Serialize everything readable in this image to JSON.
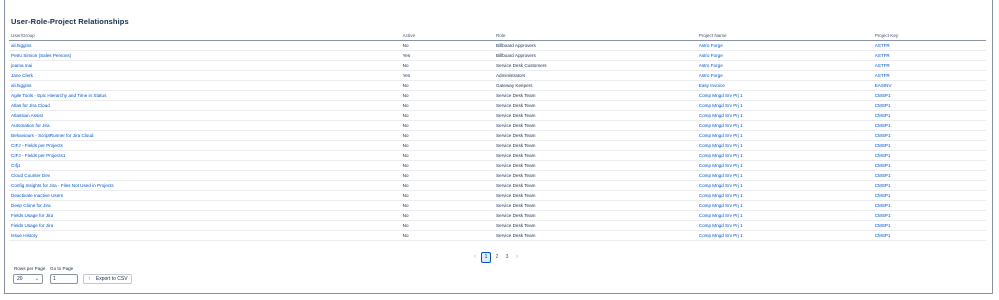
{
  "title": "User-Role-Project Relationships",
  "columns": {
    "user": "User/Group",
    "active": "Active",
    "role": "Role",
    "project_name": "Project Name",
    "project_key": "Project Key"
  },
  "rows": [
    {
      "user": "ali.higgins",
      "active": "No",
      "role": "Billboard Approvers",
      "project_name": "Astro Forge",
      "project_key": "ASTFR"
    },
    {
      "user": "Petru Simion (Sales Persons)",
      "active": "Yes",
      "role": "Billboard Approvers",
      "project_name": "Astro Forge",
      "project_key": "ASTFR"
    },
    {
      "user": "joama mai",
      "active": "No",
      "role": "Service Desk Customers",
      "project_name": "Astro Forge",
      "project_key": "ASTFR"
    },
    {
      "user": "Jane Clerk",
      "active": "Yes",
      "role": "Administrators",
      "project_name": "Astro Forge",
      "project_key": "ASTFR"
    },
    {
      "user": "ali.higgins",
      "active": "No",
      "role": "Gateway Keepers",
      "project_name": "Easy Invoice",
      "project_key": "EASINV"
    },
    {
      "user": "Agile Tools - Epic Hierarchy and Time in Status",
      "active": "No",
      "role": "Service Desk Team",
      "project_name": "Comp Mngd Srv Prj 1",
      "project_key": "CMSP1"
    },
    {
      "user": "Atlas for Jira Cloud",
      "active": "No",
      "role": "Service Desk Team",
      "project_name": "Comp Mngd Srv Prj 1",
      "project_key": "CMSP1"
    },
    {
      "user": "Atlassian Assist",
      "active": "No",
      "role": "Service Desk Team",
      "project_name": "Comp Mngd Srv Prj 1",
      "project_key": "CMSP1"
    },
    {
      "user": "Automation for Jira",
      "active": "No",
      "role": "Service Desk Team",
      "project_name": "Comp Mngd Srv Prj 1",
      "project_key": "CMSP1"
    },
    {
      "user": "Behaviours - ScriptRunner for Jira Cloud",
      "active": "No",
      "role": "Service Desk Team",
      "project_name": "Comp Mngd Srv Prj 1",
      "project_key": "CMSP1"
    },
    {
      "user": "CIFJ - Fields per Projects",
      "active": "No",
      "role": "Service Desk Team",
      "project_name": "Comp Mngd Srv Prj 1",
      "project_key": "CMSP1"
    },
    {
      "user": "CIFJ - Fields per Projects1",
      "active": "No",
      "role": "Service Desk Team",
      "project_name": "Comp Mngd Srv Prj 1",
      "project_key": "CMSP1"
    },
    {
      "user": "CIfj1",
      "active": "No",
      "role": "Service Desk Team",
      "project_name": "Comp Mngd Srv Prj 1",
      "project_key": "CMSP1"
    },
    {
      "user": "Cloud Counter Dev",
      "active": "No",
      "role": "Service Desk Team",
      "project_name": "Comp Mngd Srv Prj 1",
      "project_key": "CMSP1"
    },
    {
      "user": "Config Insights for Jira - Files Not Used in Projects",
      "active": "No",
      "role": "Service Desk Team",
      "project_name": "Comp Mngd Srv Prj 1",
      "project_key": "CMSP1"
    },
    {
      "user": "Deactivate Inactive Users",
      "active": "No",
      "role": "Service Desk Team",
      "project_name": "Comp Mngd Srv Prj 1",
      "project_key": "CMSP1"
    },
    {
      "user": "Deep Clone for Jira",
      "active": "No",
      "role": "Service Desk Team",
      "project_name": "Comp Mngd Srv Prj 1",
      "project_key": "CMSP1"
    },
    {
      "user": "Fields Usage for Jira",
      "active": "No",
      "role": "Service Desk Team",
      "project_name": "Comp Mngd Srv Prj 1",
      "project_key": "CMSP1"
    },
    {
      "user": "Fields Usage for Jira",
      "active": "No",
      "role": "Service Desk Team",
      "project_name": "Comp Mngd Srv Prj 1",
      "project_key": "CMSP1"
    },
    {
      "user": "Issue History",
      "active": "No",
      "role": "Service Desk Team",
      "project_name": "Comp Mngd Srv Prj 1",
      "project_key": "CMSP1"
    }
  ],
  "pagination": {
    "prev_icon": "chevron-left-icon",
    "next_icon": "chevron-right-icon",
    "pages": [
      "1",
      "2",
      "3"
    ],
    "current": "1"
  },
  "footer": {
    "rows_per_page_label": "Rows per Page",
    "rows_per_page_value": "20",
    "go_to_page_label": "Go to Page",
    "go_to_page_value": "1",
    "export_label": "Export to CSV",
    "export_icon": "upload-arrow-icon"
  },
  "colors": {
    "link": "#0052cc",
    "text": "#172b4d",
    "current_page_border": "#0052cc"
  }
}
